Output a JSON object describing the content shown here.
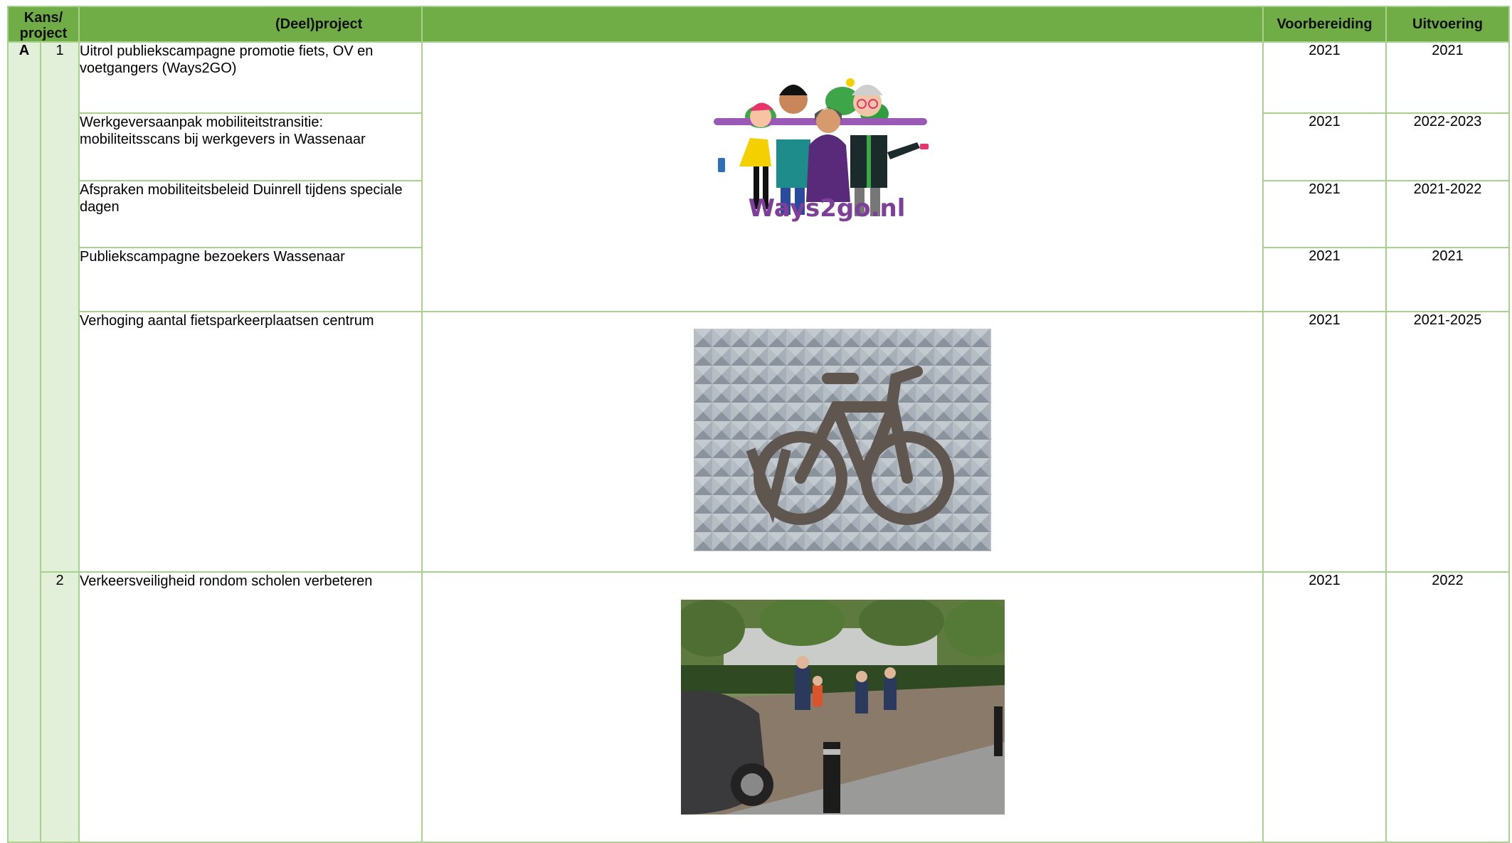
{
  "header": {
    "kans_project": "Kans/\nproject",
    "deelproject": "(Deel)project",
    "voorbereiding": "Voorbereiding",
    "uitvoering": "Uitvoering"
  },
  "kans": "A",
  "groups": [
    {
      "project": "1",
      "rows": [
        {
          "name": "Uitrol publiekscampagne promotie fiets, OV en voetgangers (Ways2GO)",
          "voorbereiding": "2021",
          "uitvoering": "2021"
        },
        {
          "name": "Werkgeversaanpak mobiliteitstransitie: mobiliteitsscans bij werkgevers in Wassenaar",
          "voorbereiding": "2021",
          "uitvoering": "2022-2023"
        },
        {
          "name": "Afspraken mobiliteitsbeleid Duinrell tijdens speciale dagen",
          "voorbereiding": "2021",
          "uitvoering": "2021-2022"
        },
        {
          "name": "Publiekscampagne bezoekers Wassenaar",
          "voorbereiding": "2021",
          "uitvoering": "2021"
        },
        {
          "name": "Verhoging aantal fietsparkeerplaatsen centrum",
          "voorbereiding": "2021",
          "uitvoering": "2021-2025"
        }
      ]
    },
    {
      "project": "2",
      "rows": [
        {
          "name": "Verkeersveiligheid rondom scholen verbeteren",
          "voorbereiding": "2021",
          "uitvoering": "2022"
        }
      ]
    }
  ],
  "images": {
    "ways2go": {
      "logo_text": "Ways2go.nl",
      "colors": {
        "purple": "#7e3f98",
        "green": "#2e9e3e",
        "yellow": "#f5d000",
        "pink": "#e8336b"
      }
    },
    "bike_wall": {
      "description_icon": "bicycle-sign-icon"
    },
    "school": {
      "description_icon": "children-crossing-photo"
    }
  },
  "colors": {
    "header_bg": "#70ad47",
    "light_bg": "#e2efd9",
    "border": "#a8d18d"
  }
}
